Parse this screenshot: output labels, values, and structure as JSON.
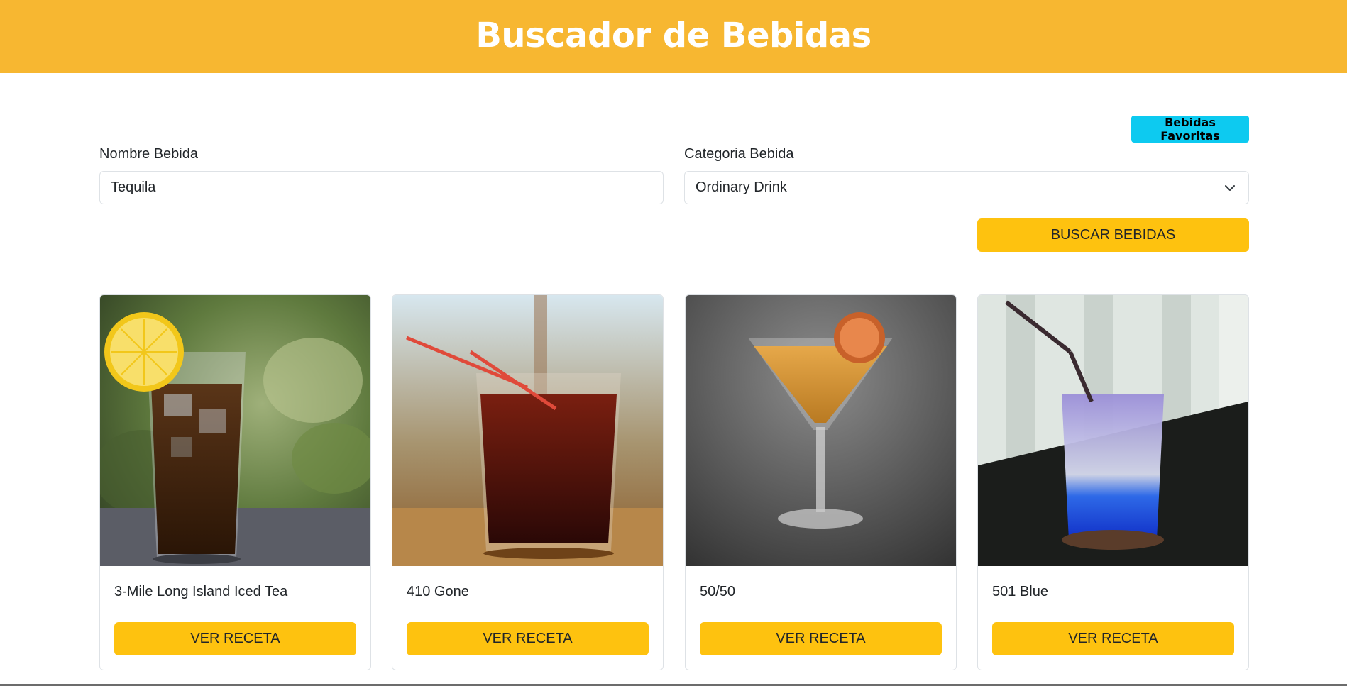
{
  "header": {
    "title": "Buscador de Bebidas"
  },
  "favorites_button": {
    "label": "Bebidas Favoritas"
  },
  "form": {
    "name_label": "Nombre Bebida",
    "name_value": "Tequila",
    "category_label": "Categoria Bebida",
    "category_value": "Ordinary Drink",
    "search_button": "BUSCAR BEBIDAS"
  },
  "drinks": [
    {
      "name": "3-Mile Long Island Iced Tea",
      "button": "VER RECETA"
    },
    {
      "name": "410 Gone",
      "button": "VER RECETA"
    },
    {
      "name": "50/50",
      "button": "VER RECETA"
    },
    {
      "name": "501 Blue",
      "button": "VER RECETA"
    }
  ],
  "colors": {
    "header_bg": "#f7b731",
    "button_yellow": "#fec20f",
    "favorites_cyan": "#0dcaf0"
  }
}
